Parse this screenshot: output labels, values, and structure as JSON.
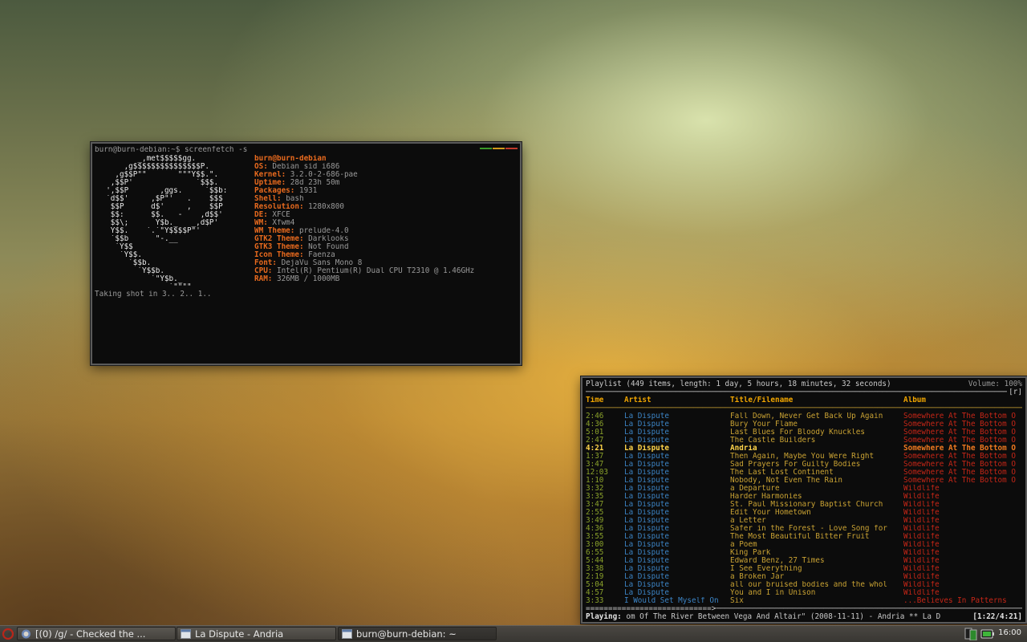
{
  "terminal1": {
    "prompt": "burn@burn-debian:~$ screenfetch -s",
    "logo": [
      "         _,met$$$$$gg.",
      "      ,g$$$$$$$$$$$$$$$P.",
      "    ,g$$P\"\"       \"\"\"Y$$.\".",
      "   ,$$P'              `$$$.",
      "  ',$$P       ,ggs.     `$$b:",
      "  `d$$'     ,$P\"'   .    $$$",
      "   $$P      d$'     ,    $$P",
      "   $$:      $$.   -    ,d$$'",
      "   $$\\;      Y$b._   _,d$P'",
      "   Y$$.    `.`\"Y$$$$P\"'",
      "   `$$b      \"-.__",
      "    `Y$$",
      "     `Y$$.",
      "       `$$b.",
      "         `Y$$b.",
      "            `\"Y$b._",
      "                `\"\"\"\""
    ],
    "user_host": "burn@burn-debian",
    "info": [
      {
        "k": "OS:",
        "v": " Debian sid i686"
      },
      {
        "k": "Kernel:",
        "v": " 3.2.0-2-686-pae"
      },
      {
        "k": "Uptime:",
        "v": " 28d 23h 50m"
      },
      {
        "k": "Packages:",
        "v": " 1931"
      },
      {
        "k": "Shell:",
        "v": " bash"
      },
      {
        "k": "Resolution:",
        "v": " 1280x800"
      },
      {
        "k": "DE:",
        "v": " XFCE"
      },
      {
        "k": "WM:",
        "v": " Xfwm4"
      },
      {
        "k": "WM Theme:",
        "v": " prelude-4.0"
      },
      {
        "k": "GTK2 Theme:",
        "v": " Darklooks"
      },
      {
        "k": "GTK3 Theme:",
        "v": " Not Found"
      },
      {
        "k": "Icon Theme:",
        "v": " Faenza"
      },
      {
        "k": "Font:",
        "v": " DejaVu Sans Mono 8"
      },
      {
        "k": "CPU:",
        "v": " Intel(R) Pentium(R) Dual CPU T2310 @ 1.46GHz"
      },
      {
        "k": "RAM:",
        "v": " 326MB / 1000MB"
      }
    ],
    "footer": "Taking shot in 3.. 2.. 1..",
    "title_colors": [
      "#3a9a28",
      "#d19a1c",
      "#c0392b"
    ]
  },
  "ncmpcpp": {
    "header": "Playlist (449 items, length: 1 day, 5 hours, 18 minutes, 32 seconds)",
    "volume": "Volume: 100%",
    "flag": "[r]",
    "columns": {
      "time": "Time",
      "artist": "Artist",
      "title": "Title/Filename",
      "album": "Album"
    },
    "rows": [
      [
        "2:46",
        "La Dispute",
        "Fall Down, Never Get Back Up Again",
        "Somewhere At The Bottom O"
      ],
      [
        "4:36",
        "La Dispute",
        "Bury Your Flame",
        "Somewhere At The Bottom O"
      ],
      [
        "5:01",
        "La Dispute",
        "Last Blues For Bloody Knuckles",
        "Somewhere At The Bottom O"
      ],
      [
        "2:47",
        "La Dispute",
        "The Castle Builders",
        "Somewhere At The Bottom O"
      ],
      [
        "4:21",
        "La Dispute",
        "Andria",
        "Somewhere At The Bottom O"
      ],
      [
        "1:37",
        "La Dispute",
        "Then Again, Maybe You Were Right",
        "Somewhere At The Bottom O"
      ],
      [
        "3:47",
        "La Dispute",
        "Sad Prayers For Guilty Bodies",
        "Somewhere At The Bottom O"
      ],
      [
        "12:03",
        "La Dispute",
        "The Last Lost Continent",
        "Somewhere At The Bottom O"
      ],
      [
        "1:10",
        "La Dispute",
        "Nobody, Not Even The Rain",
        "Somewhere At The Bottom O"
      ],
      [
        "3:32",
        "La Dispute",
        "a Departure",
        "Wildlife"
      ],
      [
        "3:35",
        "La Dispute",
        "Harder Harmonies",
        "Wildlife"
      ],
      [
        "3:47",
        "La Dispute",
        "St. Paul Missionary Baptist Church",
        "Wildlife"
      ],
      [
        "2:55",
        "La Dispute",
        "Edit Your Hometown",
        "Wildlife"
      ],
      [
        "3:49",
        "La Dispute",
        "a Letter",
        "Wildlife"
      ],
      [
        "4:36",
        "La Dispute",
        "Safer in the Forest - Love Song for",
        "Wildlife"
      ],
      [
        "3:55",
        "La Dispute",
        "The Most Beautiful Bitter Fruit",
        "Wildlife"
      ],
      [
        "3:00",
        "La Dispute",
        "a Poem",
        "Wildlife"
      ],
      [
        "6:55",
        "La Dispute",
        "King Park",
        "Wildlife"
      ],
      [
        "5:44",
        "La Dispute",
        "Edward Benz, 27 Times",
        "Wildlife"
      ],
      [
        "3:38",
        "La Dispute",
        "I See Everything",
        "Wildlife"
      ],
      [
        "2:19",
        "La Dispute",
        "a Broken Jar",
        "Wildlife"
      ],
      [
        "5:04",
        "La Dispute",
        "all our bruised bodies and the whol",
        "Wildlife"
      ],
      [
        "4:57",
        "La Dispute",
        "You and I in Unison",
        "Wildlife"
      ],
      [
        "3:33",
        "I Would Set Myself On",
        "Six",
        "...Believes In Patterns"
      ]
    ],
    "current_index": 4,
    "progress_bar": "============================>",
    "progress_fraction": 0.337,
    "status_label": "Playing:",
    "status_text": " om Of The River Between Vega And Altair\" (2008-11-11) - Andria ** La D",
    "status_time": "[1:22/4:21]"
  },
  "taskbar": {
    "tasks": [
      {
        "label": "[(0) /g/ - Checked the ...",
        "icon": "browser-icon"
      },
      {
        "label": "La Dispute - Andria",
        "icon": "terminal-icon"
      },
      {
        "label": "burn@burn-debian: ~",
        "icon": "terminal-icon"
      }
    ],
    "clock": "16:00",
    "tray_icons": [
      "network-icon",
      "battery-icon"
    ]
  }
}
